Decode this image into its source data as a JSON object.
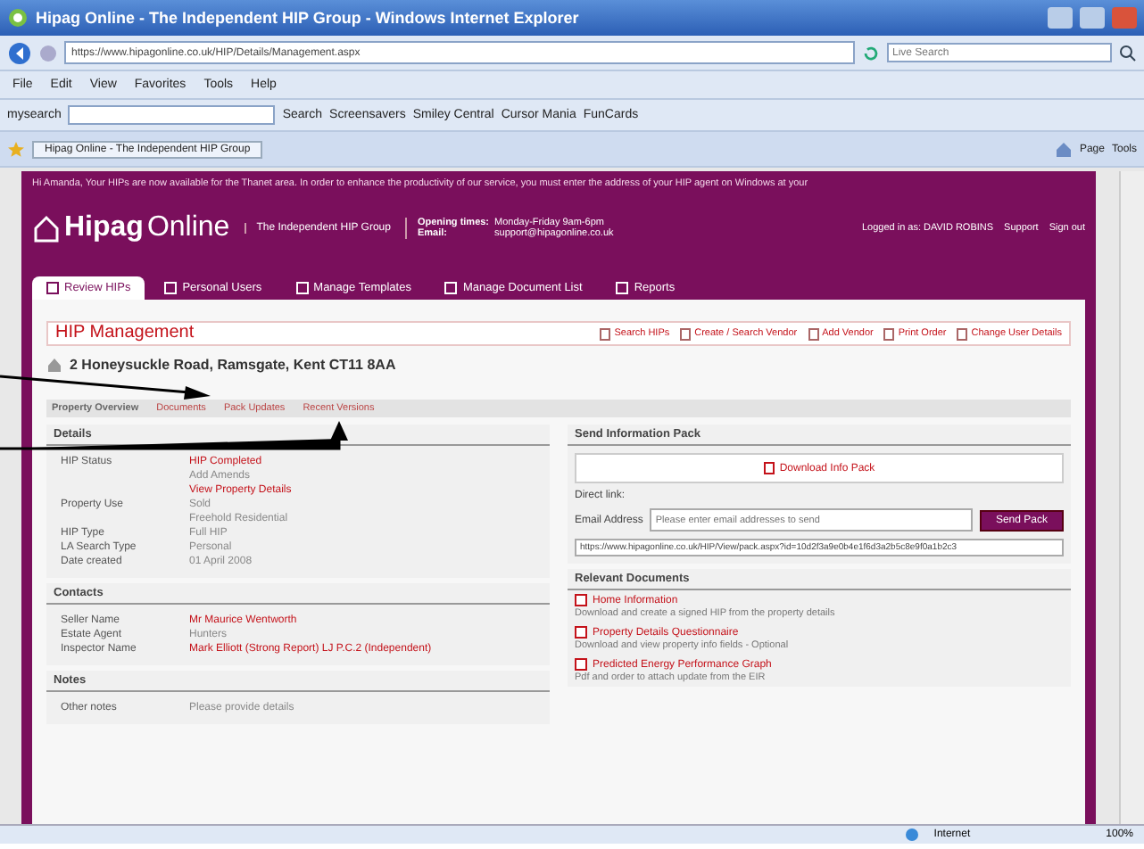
{
  "window": {
    "title": "Hipag Online - The Independent HIP Group - Windows Internet Explorer"
  },
  "address_bar": {
    "url": "https://www.hipagonline.co.uk/HIP/Details/Management.aspx"
  },
  "search_box": {
    "placeholder": "Live Search"
  },
  "menu": [
    "File",
    "Edit",
    "View",
    "Favorites",
    "Tools",
    "Help"
  ],
  "toolbar": {
    "brand": "mysearch",
    "items": [
      "Search",
      "Screensavers",
      "Smiley Central",
      "Cursor Mania",
      "FunCards"
    ]
  },
  "browser_tab": {
    "title": "Hipag Online - The Independent HIP Group"
  },
  "command_bar": [
    "Page",
    "Tools"
  ],
  "site": {
    "notice": "Hi Amanda, Your HIPs are now available for the Thanet area. In order to enhance the productivity of our service, you must enter the address of your HIP agent on Windows at your",
    "logo": "Hipag",
    "logo_suffix": "Online",
    "tagline": "The Independent HIP Group",
    "contact": [
      {
        "label": "Opening times:",
        "value": "Monday-Friday 9am-6pm"
      },
      {
        "label": "Email:",
        "value": "support@hipagonline.co.uk"
      }
    ],
    "login": "Logged in as: DAVID ROBINS",
    "links": [
      "Support",
      "Sign out"
    ],
    "nav_tabs": [
      {
        "label": "Review HIPs",
        "selected": true
      },
      {
        "label": "Personal Users",
        "selected": false
      },
      {
        "label": "Manage Templates",
        "selected": false
      },
      {
        "label": "Manage Document List",
        "selected": false
      },
      {
        "label": "Reports",
        "selected": false
      }
    ]
  },
  "management": {
    "title": "HIP Management",
    "actions": [
      "Search HIPs",
      "Create / Search Vendor",
      "Add Vendor",
      "Print Order",
      "Change User Details"
    ]
  },
  "property": {
    "address": "2 Honeysuckle Road, Ramsgate, Kent CT11 8AA",
    "tabs": [
      {
        "label": "Property Overview",
        "selected": true
      },
      {
        "label": "Documents",
        "selected": false
      },
      {
        "label": "Pack Updates",
        "selected": false
      },
      {
        "label": "Recent Versions",
        "selected": false
      }
    ]
  },
  "details": {
    "heading": "Details",
    "rows": [
      {
        "label": "HIP Status",
        "values": [
          {
            "text": "HIP Completed",
            "link": true
          },
          {
            "text": "Add Amends",
            "link": false
          },
          {
            "text": "View Property Details",
            "link": true
          }
        ]
      },
      {
        "label": "Property Use",
        "values": [
          {
            "text": "Sold",
            "link": false
          },
          {
            "text": "Freehold Residential",
            "link": false
          }
        ]
      },
      {
        "label": "HIP Type",
        "values": [
          {
            "text": "Full HIP",
            "link": false
          }
        ]
      },
      {
        "label": "LA Search Type",
        "values": [
          {
            "text": "Personal",
            "link": false
          }
        ]
      },
      {
        "label": "Date created",
        "values": [
          {
            "text": "01 April 2008",
            "link": false
          }
        ]
      }
    ]
  },
  "contacts": {
    "heading": "Contacts",
    "rows": [
      {
        "label": "Seller Name",
        "values": [
          {
            "text": "Mr Maurice Wentworth",
            "link": true
          }
        ]
      },
      {
        "label": "Estate Agent",
        "values": [
          {
            "text": "Hunters",
            "link": false
          }
        ]
      },
      {
        "label": "Inspector Name",
        "values": [
          {
            "text": "Mark Elliott (Strong Report) LJ P.C.2 (Independent)",
            "link": true
          }
        ]
      }
    ]
  },
  "notes": {
    "heading": "Notes",
    "rows": [
      {
        "label": "Other notes",
        "values": [
          {
            "text": "Please provide details",
            "link": false
          }
        ]
      }
    ]
  },
  "info_pack": {
    "heading": "Send Information Pack",
    "download": "Download Info Pack",
    "email_label": "Email Address",
    "email_placeholder": "Please enter email addresses to send",
    "send": "Send Pack",
    "link_label": "Direct link:",
    "url": "https://www.hipagonline.co.uk/HIP/View/pack.aspx?id=10d2f3a9e0b4e1f6d3a2b5c8e9f0a1b2c3"
  },
  "documents": {
    "heading": "Relevant Documents",
    "items": [
      {
        "title": "Home Information",
        "desc": "Download and create a signed HIP from the property details"
      },
      {
        "title": "Property Details Questionnaire",
        "desc": "Download and view property info fields - Optional"
      },
      {
        "title": "Predicted Energy Performance Graph",
        "desc": "Pdf and order to attach update from the EIR"
      }
    ]
  },
  "status_bar": {
    "zone": "Internet",
    "zoom": "100%"
  }
}
